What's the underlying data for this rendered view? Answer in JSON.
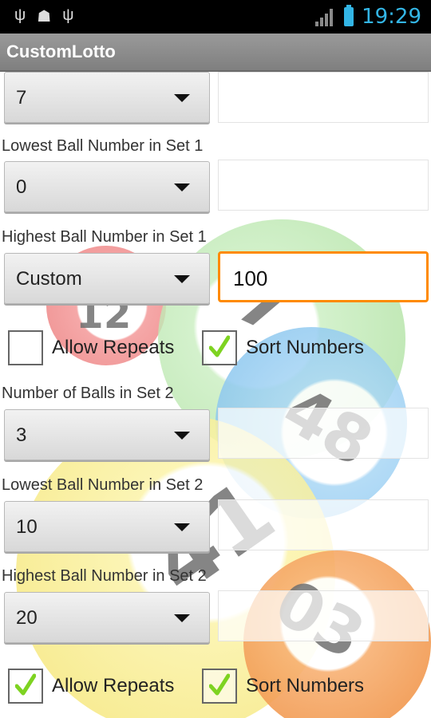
{
  "status_bar": {
    "time": "19:29",
    "icons_left": [
      "usb-icon",
      "android-debug-icon",
      "usb-icon"
    ],
    "accent_color": "#33b5e5"
  },
  "app": {
    "title": "CustomLotto"
  },
  "form": {
    "row0": {
      "spinner_value": "7",
      "field_value": ""
    },
    "set1": {
      "lowest_label": "Lowest Ball Number in Set 1",
      "lowest_value": "0",
      "lowest_field": "",
      "highest_label": "Highest Ball Number in Set 1",
      "highest_value": "Custom",
      "highest_field": "100",
      "allow_repeats": {
        "label": "Allow Repeats",
        "checked": false
      },
      "sort_numbers": {
        "label": "Sort Numbers",
        "checked": true
      }
    },
    "set2": {
      "count_label": "Number of Balls in Set 2",
      "count_value": "3",
      "count_field": "",
      "lowest_label": "Lowest Ball Number in Set 2",
      "lowest_value": "10",
      "lowest_field": "",
      "highest_label": "Highest Ball Number in Set 2",
      "highest_value": "20",
      "highest_field": "",
      "allow_repeats": {
        "label": "Allow Repeats",
        "checked": true
      },
      "sort_numbers": {
        "label": "Sort Numbers",
        "checked": true
      }
    }
  },
  "background_balls": [
    "12",
    "7",
    "48",
    "41",
    "03"
  ],
  "colors": {
    "focus_border": "#ff8a00",
    "check_green": "#7ed321"
  }
}
